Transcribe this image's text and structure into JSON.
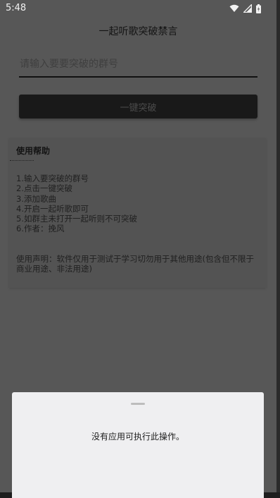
{
  "status_bar": {
    "time": "5:48",
    "icons": [
      "wifi-icon",
      "signal-icon",
      "battery-icon"
    ]
  },
  "app": {
    "title": "一起听歌突破禁言",
    "group_input": {
      "placeholder": "请输入要要突破的群号",
      "value": ""
    },
    "action_button_label": "一键突破"
  },
  "help": {
    "title": "使用帮助",
    "steps": [
      "1.输入要突破的群号",
      "2.点击一键突破",
      "3.添加歌曲",
      "4.开启一起听歌即可",
      "5.如群主未打开一起听则不可突破",
      "6.作者：挽风"
    ],
    "disclaimer": "使用声明：软件仅用于测试于学习切勿用于其他用途(包含但不限于商业用途、非法用途)"
  },
  "bottom_sheet": {
    "message": "没有应用可执行此操作。"
  },
  "colors": {
    "scrim": "#575757",
    "sheet": "#efeff1",
    "button": "#191919"
  }
}
